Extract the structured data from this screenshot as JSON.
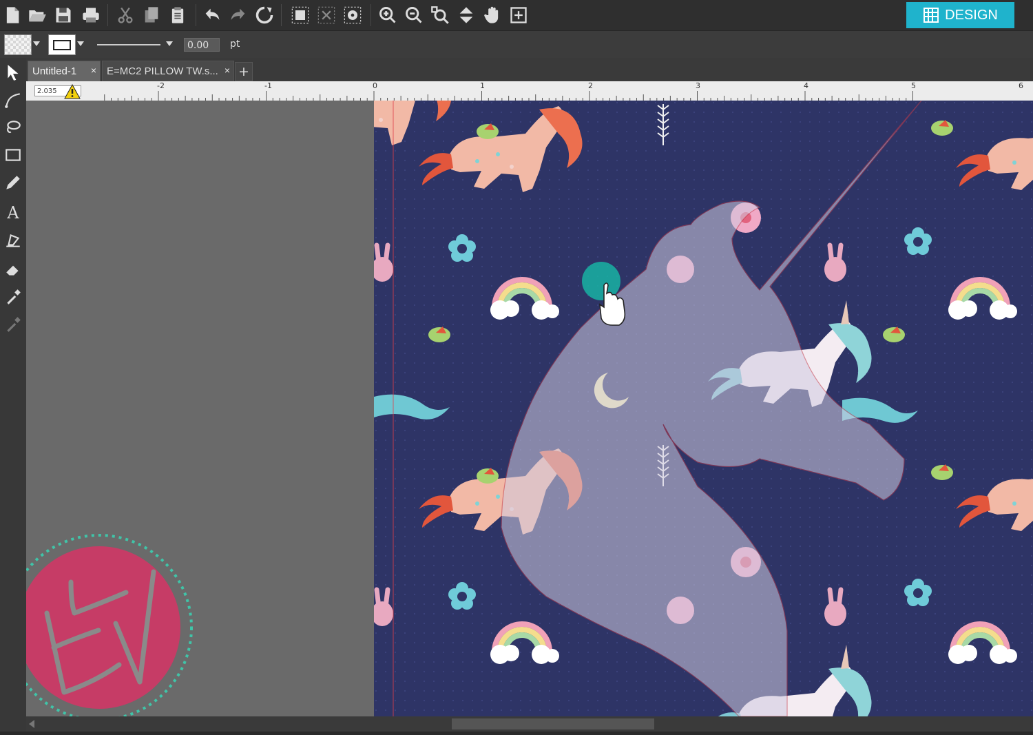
{
  "toolbar": {
    "icons": [
      "new-document-icon",
      "open-folder-icon",
      "save-icon",
      "print-icon",
      "cut-icon",
      "copy-icon",
      "paste-icon",
      "undo-icon",
      "redo-icon",
      "refresh-icon",
      "group-icon",
      "ungroup-icon",
      "compound-path-icon",
      "zoom-in-icon",
      "zoom-out-icon",
      "zoom-fit-icon",
      "move-down-icon",
      "pan-hand-icon",
      "add-page-icon"
    ],
    "design_label": "DESIGN",
    "accent_color": "#1fb3cc"
  },
  "line_bar": {
    "width_value": "0.00",
    "unit": "pt"
  },
  "tabs": [
    {
      "label": "Untitled-1",
      "close": "×"
    },
    {
      "label": "E=MC2 PILLOW TW.s...",
      "close": "×"
    }
  ],
  "tab_add": "+",
  "ruler": {
    "coord": "2.035",
    "labels": [
      "-2",
      "-1",
      "0",
      "1",
      "2",
      "3",
      "4",
      "5",
      "6"
    ]
  },
  "tools": [
    "select-arrow-icon",
    "bezier-curve-icon",
    "lasso-icon",
    "rectangle-icon",
    "pencil-icon",
    "text-icon",
    "knife-icon",
    "eraser-icon",
    "eyedropper-icon",
    "color-picker-icon"
  ],
  "watermark": {
    "text": "EV",
    "circle_color": "#c63c66",
    "ring_color": "#40c4a8"
  },
  "fabric": {
    "background_color": "#2e3466"
  }
}
